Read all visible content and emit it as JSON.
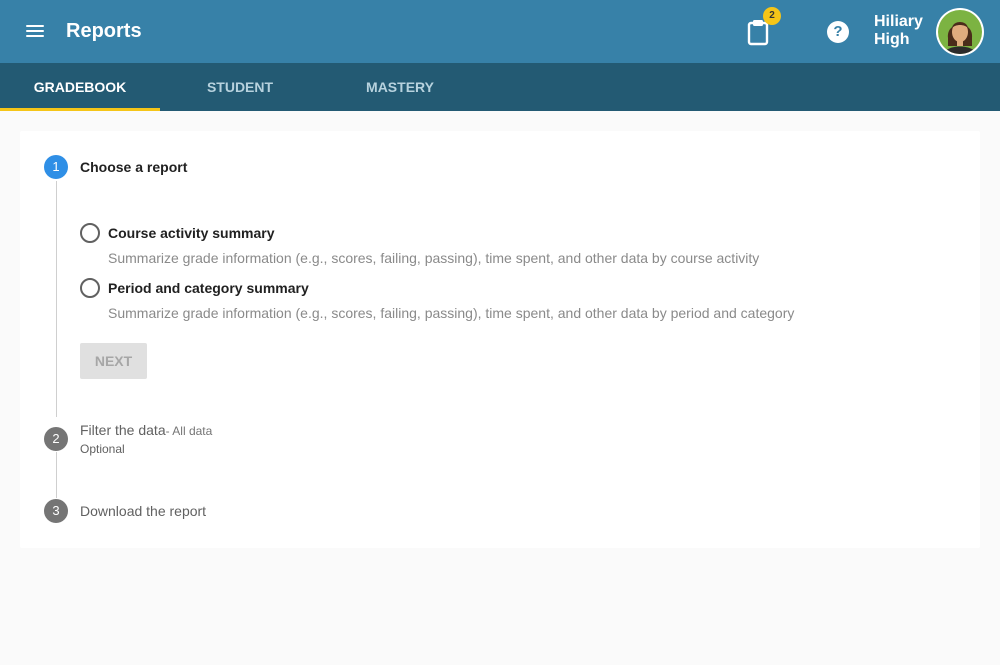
{
  "header": {
    "title": "Reports",
    "notification_count": "2",
    "help_symbol": "?",
    "user_first": "Hiliary",
    "user_last": "High",
    "icons": [
      "menu-icon",
      "clipboard-icon",
      "help-icon",
      "avatar"
    ]
  },
  "tabs": [
    {
      "label": "GRADEBOOK",
      "active": true
    },
    {
      "label": "STUDENT",
      "active": false
    },
    {
      "label": "MASTERY",
      "active": false
    }
  ],
  "steps": [
    {
      "number": "1",
      "title": "Choose a report",
      "state": "active"
    },
    {
      "number": "2",
      "title": "Filter the data",
      "sub": "- All data",
      "optional": "Optional",
      "state": "inactive"
    },
    {
      "number": "3",
      "title": "Download the report",
      "state": "inactive"
    }
  ],
  "options": [
    {
      "label": "Course activity summary",
      "description": "Summarize grade information (e.g., scores, failing, passing), time spent, and other data by course activity",
      "selected": false
    },
    {
      "label": "Period and category summary",
      "description": "Summarize grade information (e.g., scores, failing, passing), time spent, and other data by period and category",
      "selected": false
    }
  ],
  "next_button": {
    "label": "NEXT",
    "disabled": true
  },
  "colors": {
    "appbar": "#3781a8",
    "tabbar": "#235a73",
    "tab_indicator": "#f5c518",
    "active_step": "#2f8fe6",
    "inactive_step": "#757575"
  }
}
